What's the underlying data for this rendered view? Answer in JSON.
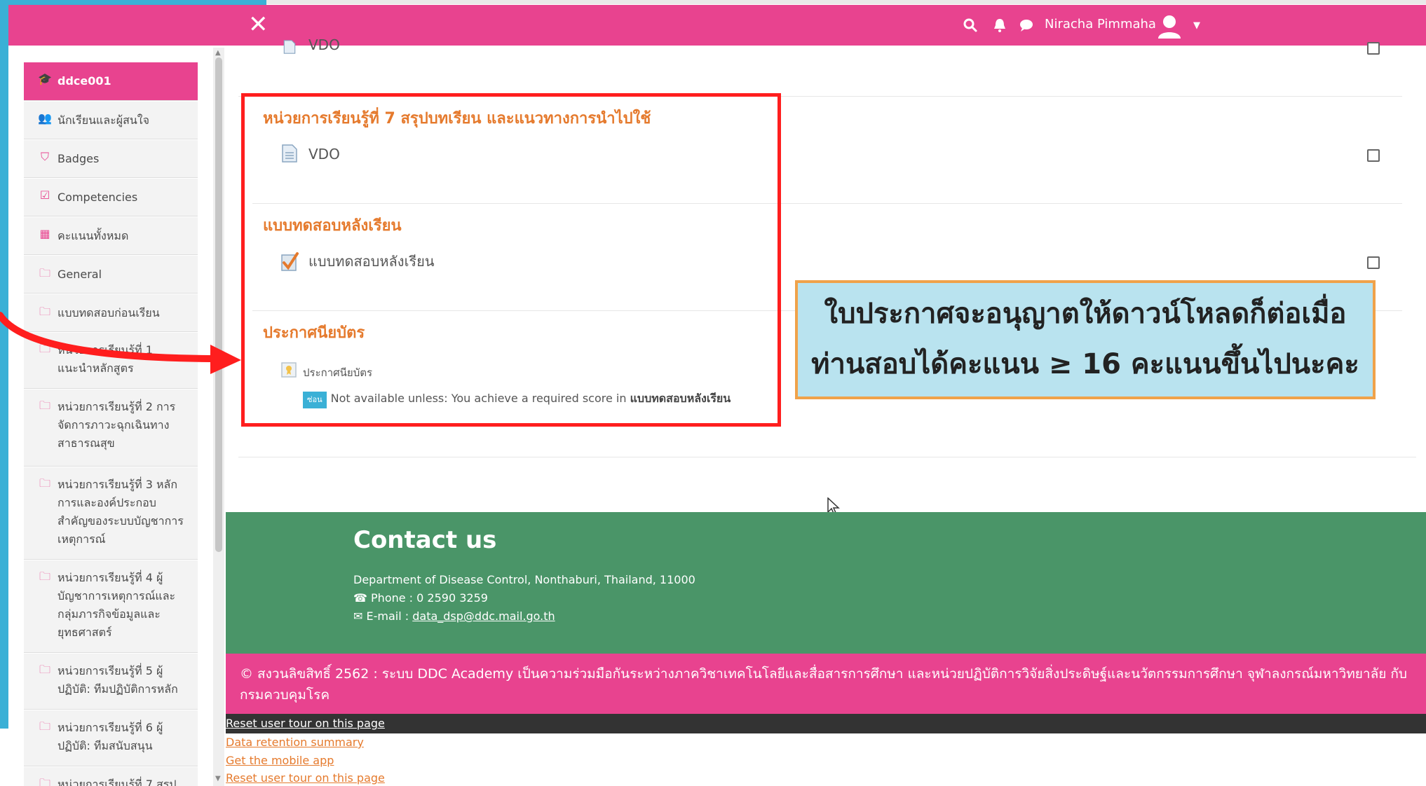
{
  "navbar": {
    "user_name": "Niracha Pimmaha"
  },
  "sidebar": {
    "items": [
      {
        "label": "ddce001",
        "icon": "graduation-cap-icon"
      },
      {
        "label": "นักเรียนและผู้สนใจ",
        "icon": "users-icon"
      },
      {
        "label": "Badges",
        "icon": "shield-icon"
      },
      {
        "label": "Competencies",
        "icon": "checkbox-icon"
      },
      {
        "label": "คะแนนทั้งหมด",
        "icon": "table-icon"
      },
      {
        "label": "General",
        "icon": "folder-icon"
      },
      {
        "label": "แบบทดสอบก่อนเรียน",
        "icon": "folder-icon"
      },
      {
        "label": "หน่วยการเรียนรู้ที่ 1 แนะนำหลักสูตร",
        "icon": "folder-icon"
      },
      {
        "label": "หน่วยการเรียนรู้ที่ 2 การจัดการภาวะฉุกเฉินทางสาธารณสุข",
        "icon": "folder-icon"
      },
      {
        "label": "หน่วยการเรียนรู้ที่ 3 หลักการและองค์ประกอบสำคัญของระบบบัญชาการเหตุการณ์",
        "icon": "folder-icon"
      },
      {
        "label": "หน่วยการเรียนรู้ที่ 4 ผู้บัญชาการเหตุการณ์และกลุ่มภารกิจข้อมูลและยุทธศาสตร์",
        "icon": "folder-icon"
      },
      {
        "label": "หน่วยการเรียนรู้ที่ 5 ผู้ปฏิบัติ: ทีมปฏิบัติการหลัก",
        "icon": "folder-icon"
      },
      {
        "label": "หน่วยการเรียนรู้ที่ 6 ผู้ปฏิบัติ: ทีมสนับสนุน",
        "icon": "folder-icon"
      },
      {
        "label": "หน่วยการเรียนรู้ที่ 7 สรุป",
        "icon": "folder-icon"
      }
    ]
  },
  "content": {
    "top_activity": "VDO",
    "section7_title": "หน่วยการเรียนรู้ที่ 7 สรุปบทเรียน และแนวทางการนำไปใช้",
    "section7_activity": "VDO",
    "posttest_title": "แบบทดสอบหลังเรียน",
    "posttest_activity": "แบบทดสอบหลังเรียน",
    "cert_title": "ประกาศนียบัตร",
    "cert_activity": "ประกาศนียบัตร",
    "restriction_badge": "ซ่อน",
    "restriction_text": "Not available unless: You achieve a required score in",
    "restriction_target": "แบบทดสอบหลังเรียน"
  },
  "callout": {
    "line1": "ใบประกาศจะอนุญาตให้ดาวน์โหลดก็ต่อเมื่อ",
    "line2": "ท่านสอบได้คะแนน ≥ 16 คะแนนขึ้นไปนะคะ"
  },
  "contact": {
    "title": "Contact us",
    "address": "Department of Disease Control, Nonthaburi, Thailand, 11000",
    "phone": "Phone : 0 2590 3259",
    "email_label": "E-mail :",
    "email": "data_dsp@ddc.mail.go.th"
  },
  "footer": {
    "copyright": "© สงวนลิขสิทธิ์ 2562 : ระบบ DDC Academy เป็นความร่วมมือกันระหว่างภาควิชาเทคโนโลยีและสื่อสารการศึกษา และหน่วยปฏิบัติการวิจัยสิ่งประดิษฐ์และนวัตกรรมการศึกษา จุฬาลงกรณ์มหาวิทยาลัย กับกรมควบคุมโรค",
    "reset_tour": "Reset user tour on this page",
    "data_retention": "Data retention summary",
    "mobile_app": "Get the mobile app",
    "reset_tour2": "Reset user tour on this page"
  },
  "colors": {
    "brand_pink": "#e8438f",
    "accent_orange": "#e57a2d",
    "footer_green": "#4a9568",
    "highlight_red": "#ff1e1e"
  }
}
